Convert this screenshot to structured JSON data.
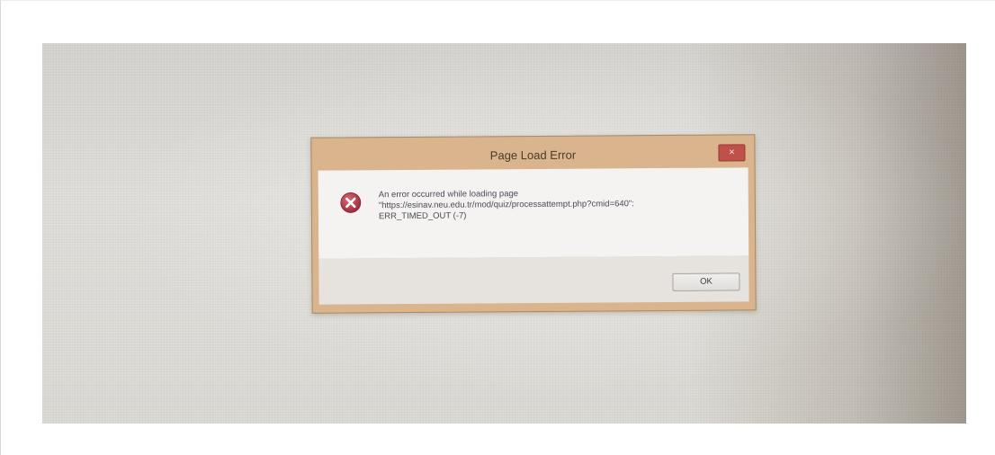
{
  "dialog": {
    "title": "Page Load Error",
    "close_label": "×",
    "message_lines": [
      "An error occurred while loading page",
      "\"https://esinav.neu.edu.tr/mod/quiz/processattempt.php?cmid=640\":",
      "ERR_TIMED_OUT (-7)"
    ],
    "ok_label": "OK",
    "icon": "error-x-icon"
  },
  "colors": {
    "dialog_frame": "#d9b48c",
    "close_button": "#c0504a",
    "error_icon": "#b53a4a"
  }
}
